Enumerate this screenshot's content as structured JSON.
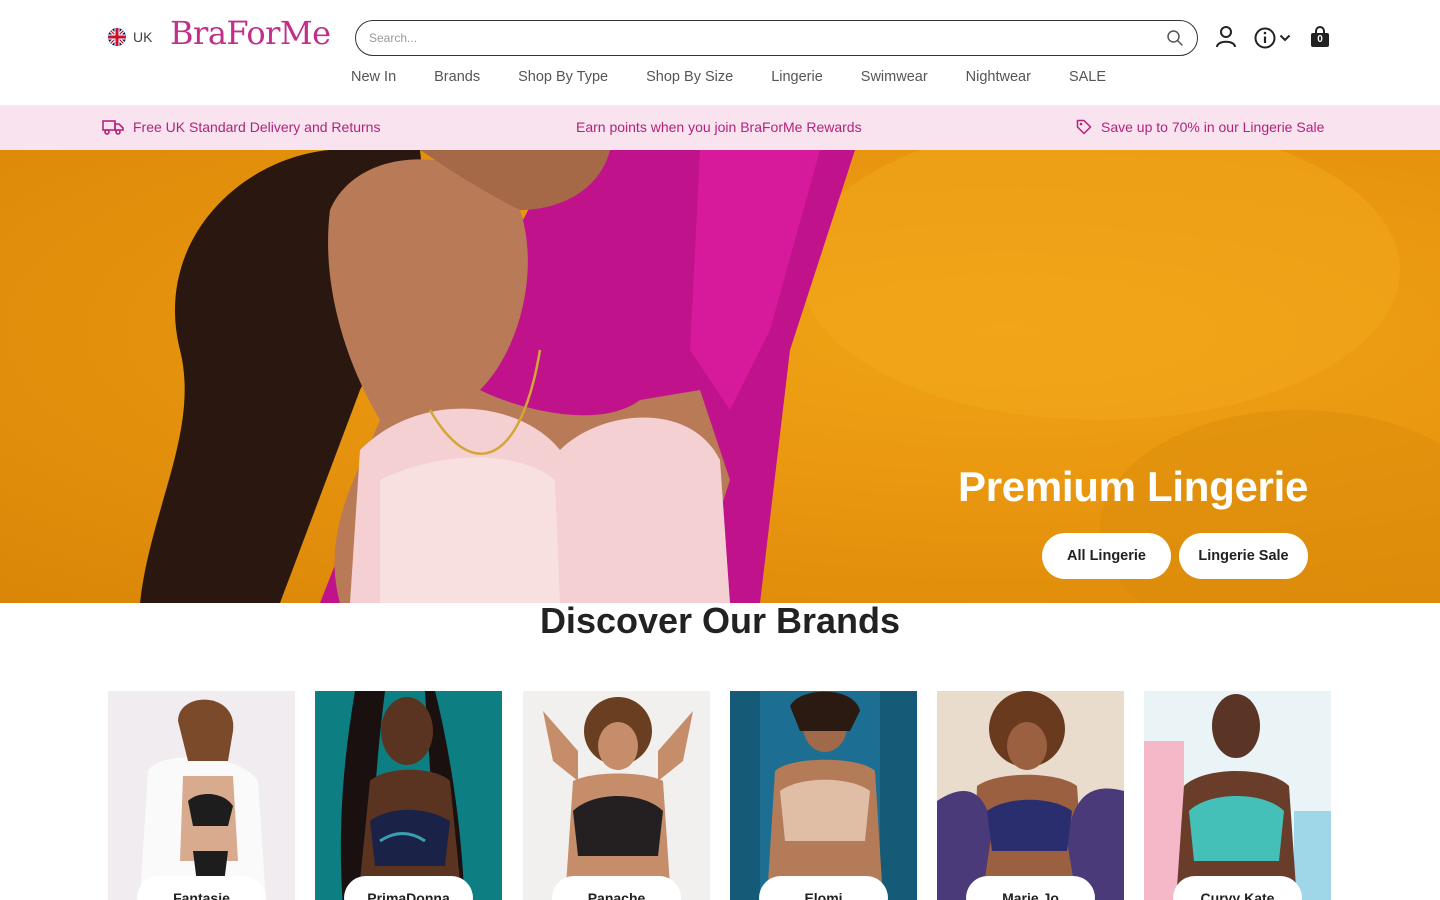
{
  "header": {
    "locale": "UK",
    "logo": "BraForMe",
    "search_placeholder": "Search...",
    "cart_count": "0",
    "icons": [
      "uk-flag-icon",
      "search-icon",
      "account-icon",
      "info-icon",
      "chevron-down-icon",
      "shopping-bag-icon"
    ]
  },
  "nav": [
    {
      "label": "New In"
    },
    {
      "label": "Brands"
    },
    {
      "label": "Shop By Type"
    },
    {
      "label": "Shop By Size"
    },
    {
      "label": "Lingerie"
    },
    {
      "label": "Swimwear"
    },
    {
      "label": "Nightwear"
    },
    {
      "label": "SALE"
    }
  ],
  "promo": {
    "delivery": "Free UK Standard Delivery and Returns",
    "rewards": "Earn points when you join BraForMe Rewards",
    "sale": "Save up to 70% in our Lingerie Sale",
    "icons": [
      "delivery-truck-icon",
      "price-tag-icon"
    ]
  },
  "hero": {
    "title": "Premium Lingerie",
    "buttons": [
      "All Lingerie",
      "Lingerie Sale"
    ]
  },
  "brands": {
    "title": "Discover Our Brands",
    "items": [
      {
        "name": "Fantasie"
      },
      {
        "name": "PrimaDonna"
      },
      {
        "name": "Panache"
      },
      {
        "name": "Elomi"
      },
      {
        "name": "Marie Jo"
      },
      {
        "name": "Curvy Kate"
      }
    ]
  },
  "colors": {
    "brand_pink": "#c0308a",
    "promo_bg": "#f8e3ef",
    "promo_text": "#b4237a",
    "hero_orange": "#e8960f"
  }
}
